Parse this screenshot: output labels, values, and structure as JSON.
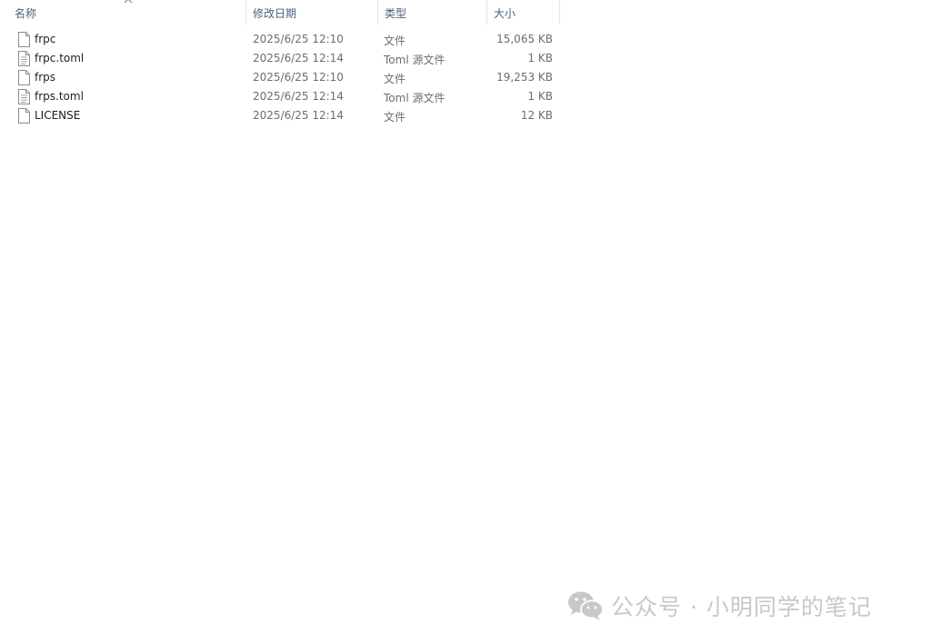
{
  "columns": {
    "name": "名称",
    "date": "修改日期",
    "type": "类型",
    "size": "大小"
  },
  "files": [
    {
      "name": "frpc",
      "date": "2025/6/25 12:10",
      "type": "文件",
      "size": "15,065 KB",
      "icon": "file-icon"
    },
    {
      "name": "frpc.toml",
      "date": "2025/6/25 12:14",
      "type": "Toml 源文件",
      "size": "1 KB",
      "icon": "text-file-icon"
    },
    {
      "name": "frps",
      "date": "2025/6/25 12:10",
      "type": "文件",
      "size": "19,253 KB",
      "icon": "file-icon"
    },
    {
      "name": "frps.toml",
      "date": "2025/6/25 12:14",
      "type": "Toml 源文件",
      "size": "1 KB",
      "icon": "text-file-icon"
    },
    {
      "name": "LICENSE",
      "date": "2025/6/25 12:14",
      "type": "文件",
      "size": "12 KB",
      "icon": "file-icon"
    }
  ],
  "watermark": {
    "text": "公众号 · 小明同学的笔记",
    "icon": "wechat-icon"
  }
}
